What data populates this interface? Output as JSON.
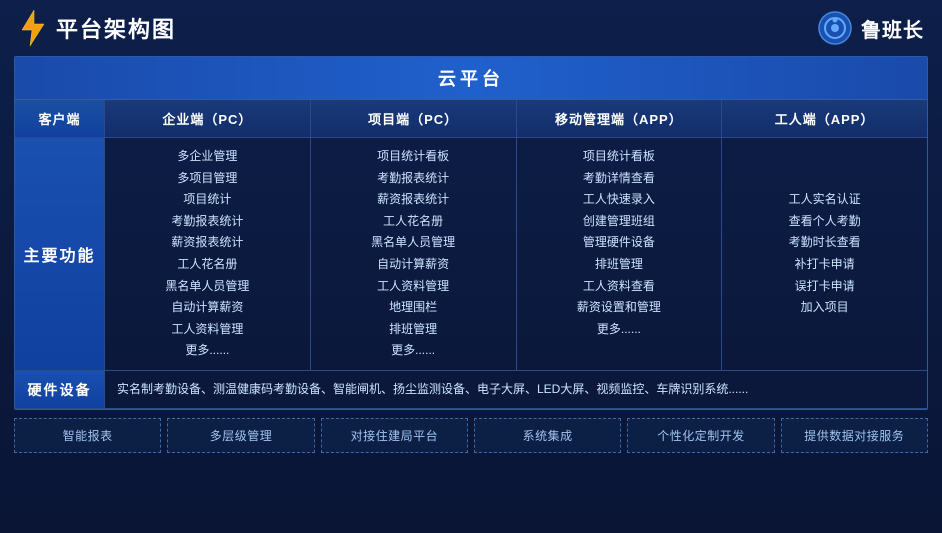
{
  "header": {
    "title": "平台架构图",
    "brand_name": "鲁班长"
  },
  "cloud_platform": {
    "label": "云平台"
  },
  "columns": {
    "client": "客户端",
    "enterprise_pc": "企业端（PC）",
    "project_pc": "项目端（PC）",
    "mobile_app": "移动管理端（APP）",
    "worker_app": "工人端（APP）"
  },
  "main_function_label": "主要功能",
  "enterprise_features": [
    "多企业管理",
    "多项目管理",
    "项目统计",
    "考勤报表统计",
    "薪资报表统计",
    "工人花名册",
    "黑名单人员管理",
    "自动计算薪资",
    "工人资料管理",
    "更多......"
  ],
  "project_features": [
    "项目统计看板",
    "考勤报表统计",
    "薪资报表统计",
    "工人花名册",
    "黑名单人员管理",
    "自动计算薪资",
    "工人资料管理",
    "地理围栏",
    "排班管理",
    "更多......"
  ],
  "mobile_features": [
    "项目统计看板",
    "考勤详情查看",
    "工人快速录入",
    "创建管理班组",
    "管理硬件设备",
    "排班管理",
    "工人资料查看",
    "薪资设置和管理",
    "更多......"
  ],
  "worker_features": [
    "工人实名认证",
    "查看个人考勤",
    "考勤时长查看",
    "补打卡申请",
    "误打卡申请",
    "加入项目"
  ],
  "hardware": {
    "label": "硬件设备",
    "content": "实名制考勤设备、测温健康码考勤设备、智能闸机、扬尘监测设备、电子大屏、LED大屏、视频监控、车牌识别系统......"
  },
  "bottom_features": [
    "智能报表",
    "多层级管理",
    "对接住建局平台",
    "系统集成",
    "个性化定制开发",
    "提供数据对接服务"
  ]
}
